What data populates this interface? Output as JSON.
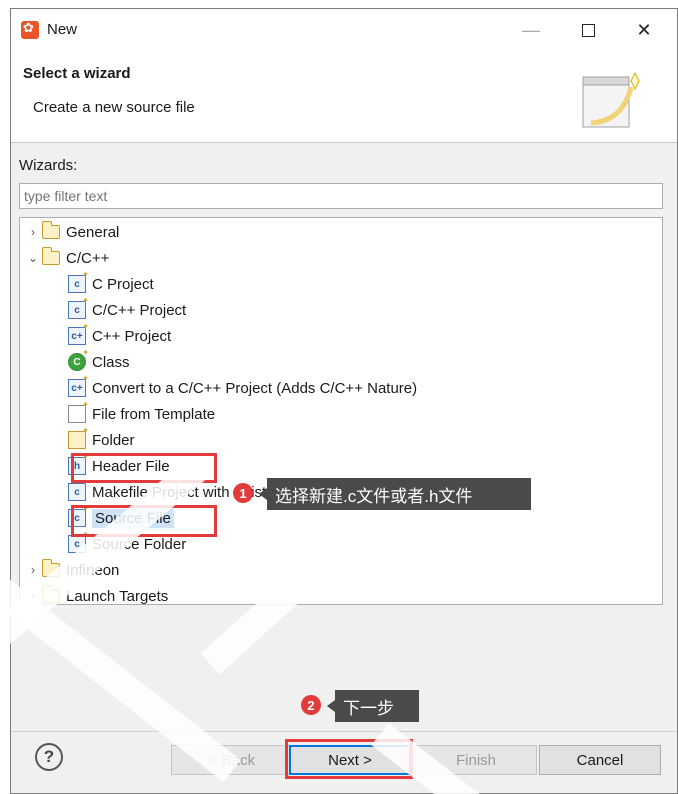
{
  "window": {
    "title": "New",
    "close_glyph": "✕",
    "minimize_glyph": "—"
  },
  "header": {
    "title": "Select a wizard",
    "description": "Create a new source file"
  },
  "wizards": {
    "label": "Wizards:",
    "filter_placeholder": "type filter text"
  },
  "tree": {
    "general": "General",
    "cpp": "C/C++",
    "items": [
      {
        "label": "C Project",
        "icon": "c-project-icon",
        "glyph": "c"
      },
      {
        "label": "C/C++ Project",
        "icon": "cpp-project-icon",
        "glyph": "c"
      },
      {
        "label": "C++ Project",
        "icon": "cplusplus-project-icon",
        "glyph": "c+"
      },
      {
        "label": "Class",
        "icon": "class-icon",
        "glyph": "C"
      },
      {
        "label": "Convert to a C/C++ Project (Adds C/C++ Nature)",
        "icon": "convert-icon",
        "glyph": "c+"
      },
      {
        "label": "File from Template",
        "icon": "file-template-icon",
        "glyph": ""
      },
      {
        "label": "Folder",
        "icon": "folder-icon",
        "glyph": ""
      },
      {
        "label": "Header File",
        "icon": "header-file-icon",
        "glyph": "h"
      },
      {
        "label": "Makefile Project with Existing Code",
        "icon": "makefile-icon",
        "glyph": "c"
      },
      {
        "label": "Source File",
        "icon": "source-file-icon",
        "glyph": "c"
      },
      {
        "label": "Source Folder",
        "icon": "source-folder-icon",
        "glyph": "c"
      }
    ],
    "infineon": "Infineon",
    "launch": "Launch Targets"
  },
  "annotations": {
    "step1_num": "1",
    "step1_text": "选择新建.c文件或者.h文件",
    "step2_num": "2",
    "step2_text": "下一步"
  },
  "buttons": {
    "help": "?",
    "back": "< Back",
    "next": "Next >",
    "finish": "Finish",
    "cancel": "Cancel"
  },
  "colors": {
    "highlight": "#e23b3b",
    "selection": "#cfe3f7",
    "callout": "#4a4a4a",
    "focus": "#0078d7"
  }
}
